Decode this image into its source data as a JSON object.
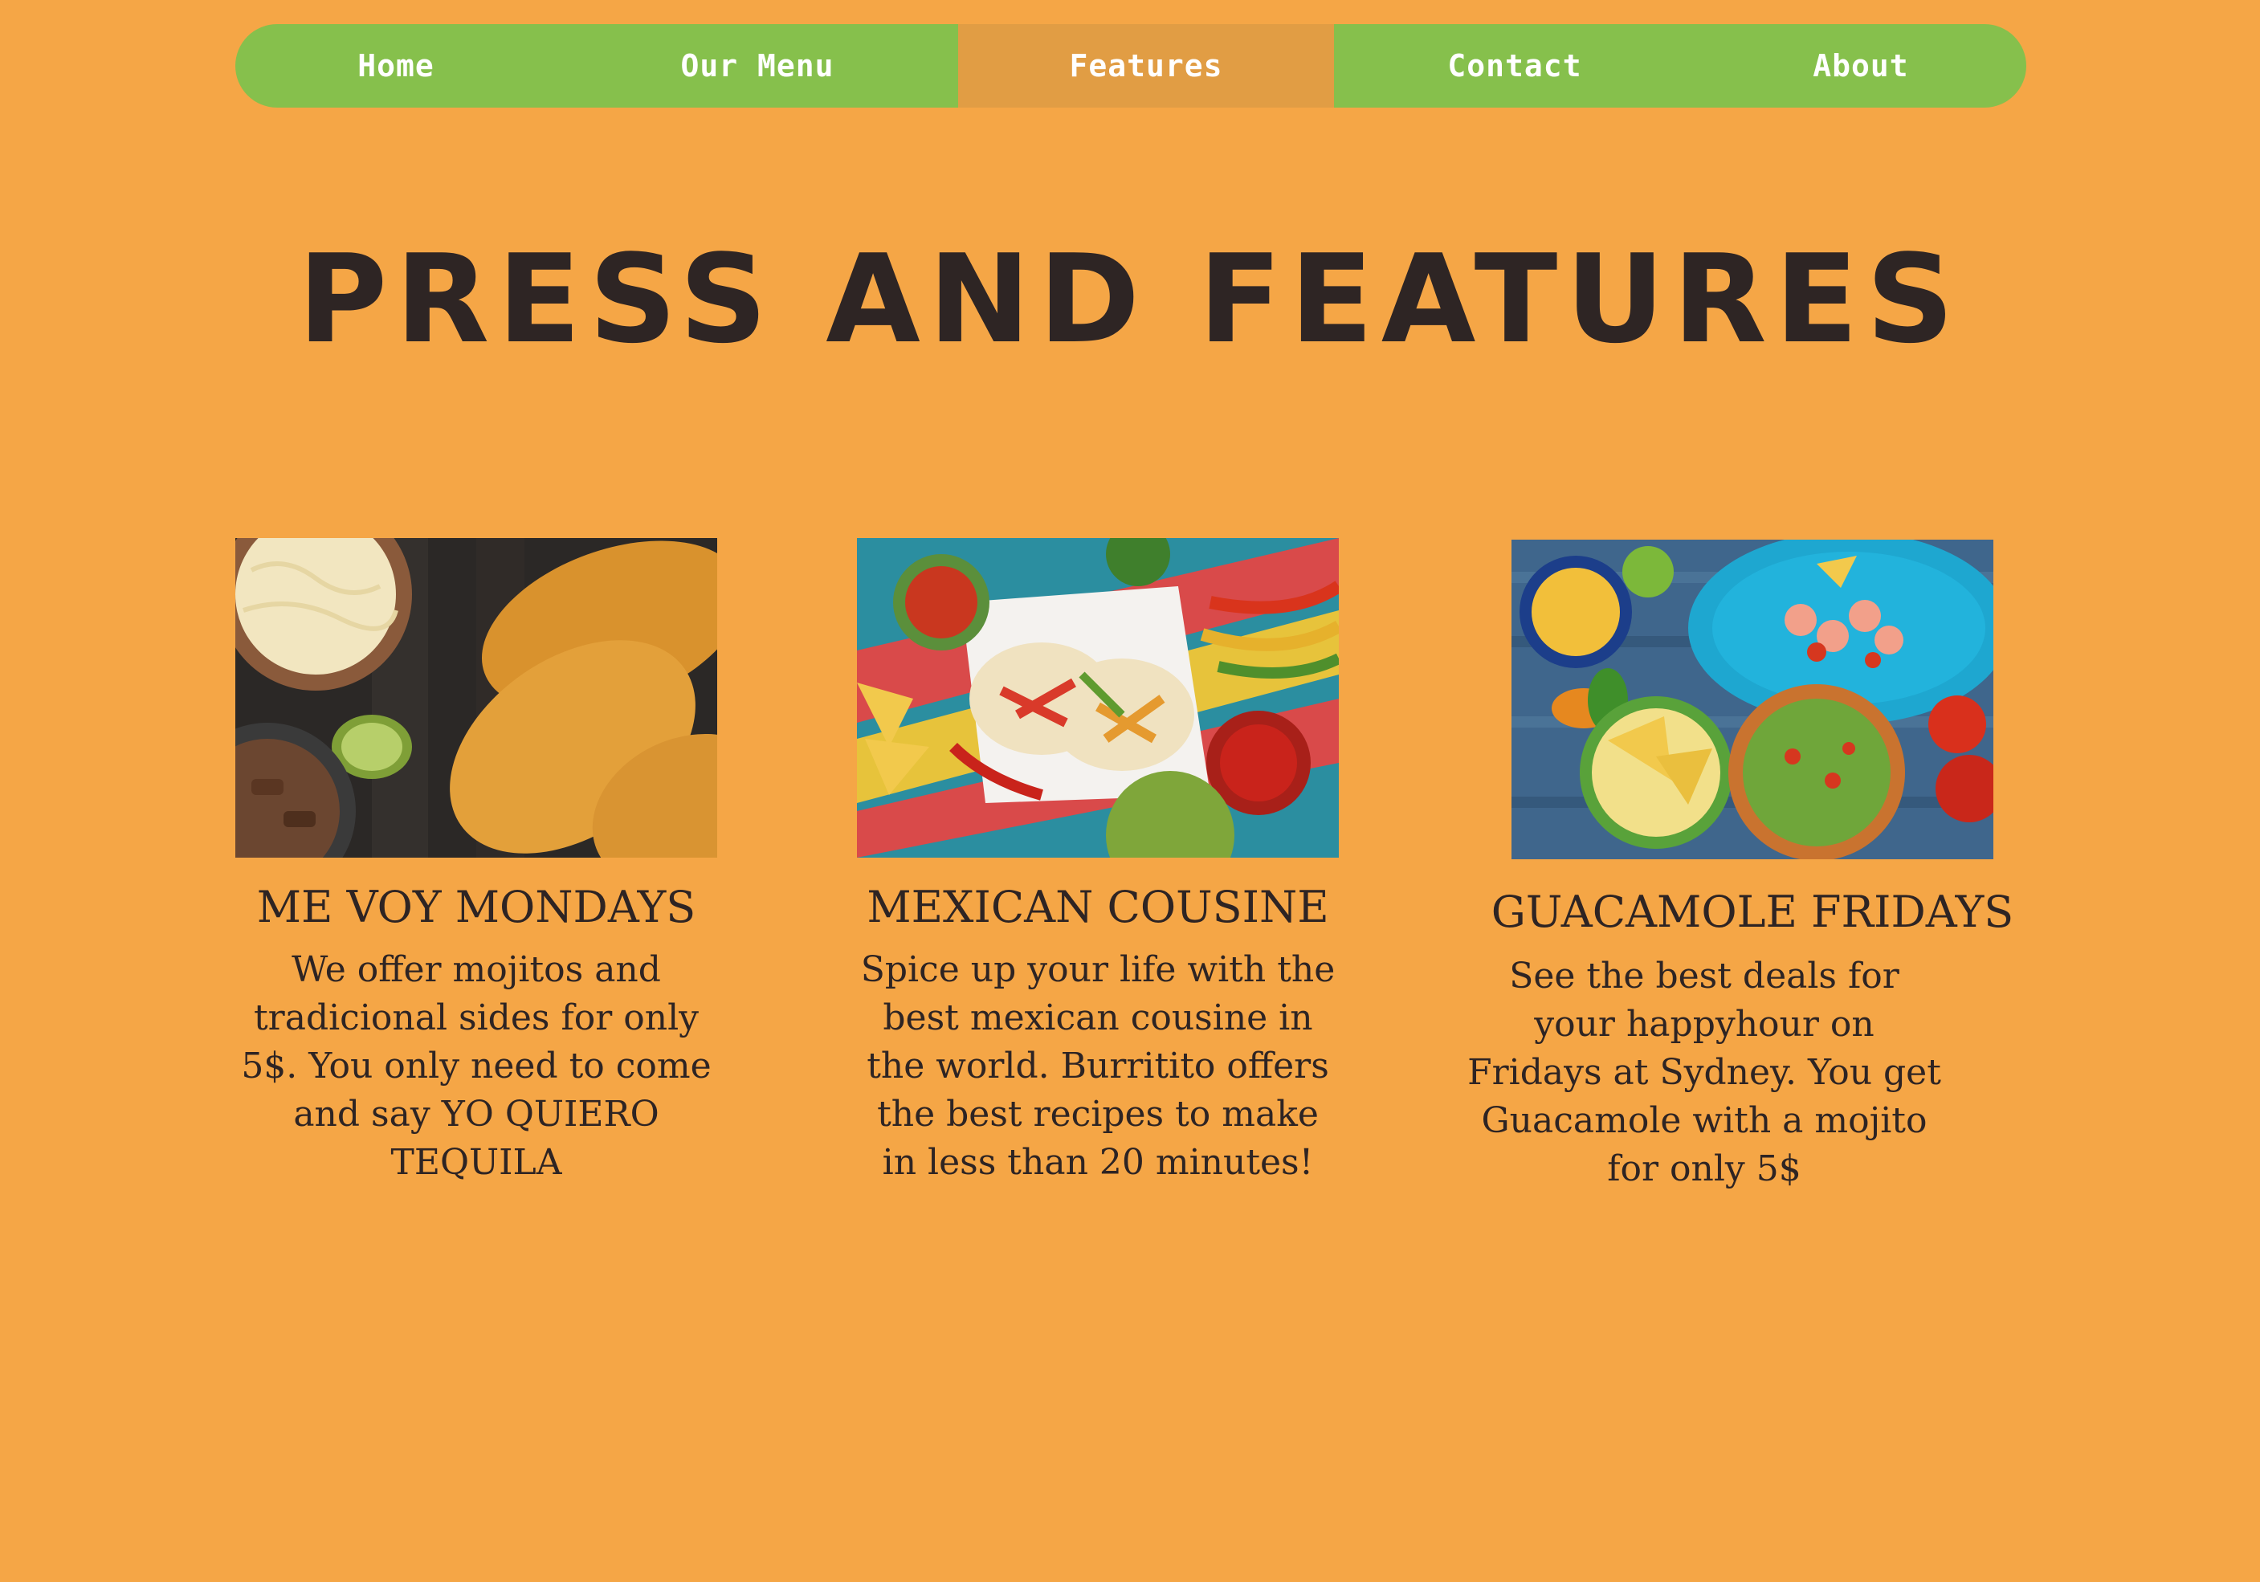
{
  "nav": {
    "items": [
      {
        "label": "Home"
      },
      {
        "label": "Our Menu"
      },
      {
        "label": "Features"
      },
      {
        "label": "Contact"
      },
      {
        "label": "About"
      }
    ],
    "active": "Features"
  },
  "page": {
    "title": "PRESS AND FEATURES"
  },
  "features": [
    {
      "image": "tacos-photo",
      "title": "ME VOY MONDAYS",
      "text": "We offer mojitos and tradicional sides for only 5$. You only need to come and say YO QUIERO TEQUILA"
    },
    {
      "image": "fajitas-photo",
      "title": "MEXICAN COUSINE",
      "text": "Spice up your life with the best mexican cousine in the world. Burritito offers the best recipes to make in less than 20 minutes!"
    },
    {
      "image": "guacamole-photo",
      "title": "GUACAMOLE FRIDAYS",
      "text": "See the best deals for your happyhour on Fridays at Sydney. You get Guacamole with a mojito for only 5$"
    }
  ],
  "colors": {
    "background": "#f5a646",
    "nav": "#86c04c",
    "nav_active": "#e19d44",
    "text": "#2e2423"
  }
}
